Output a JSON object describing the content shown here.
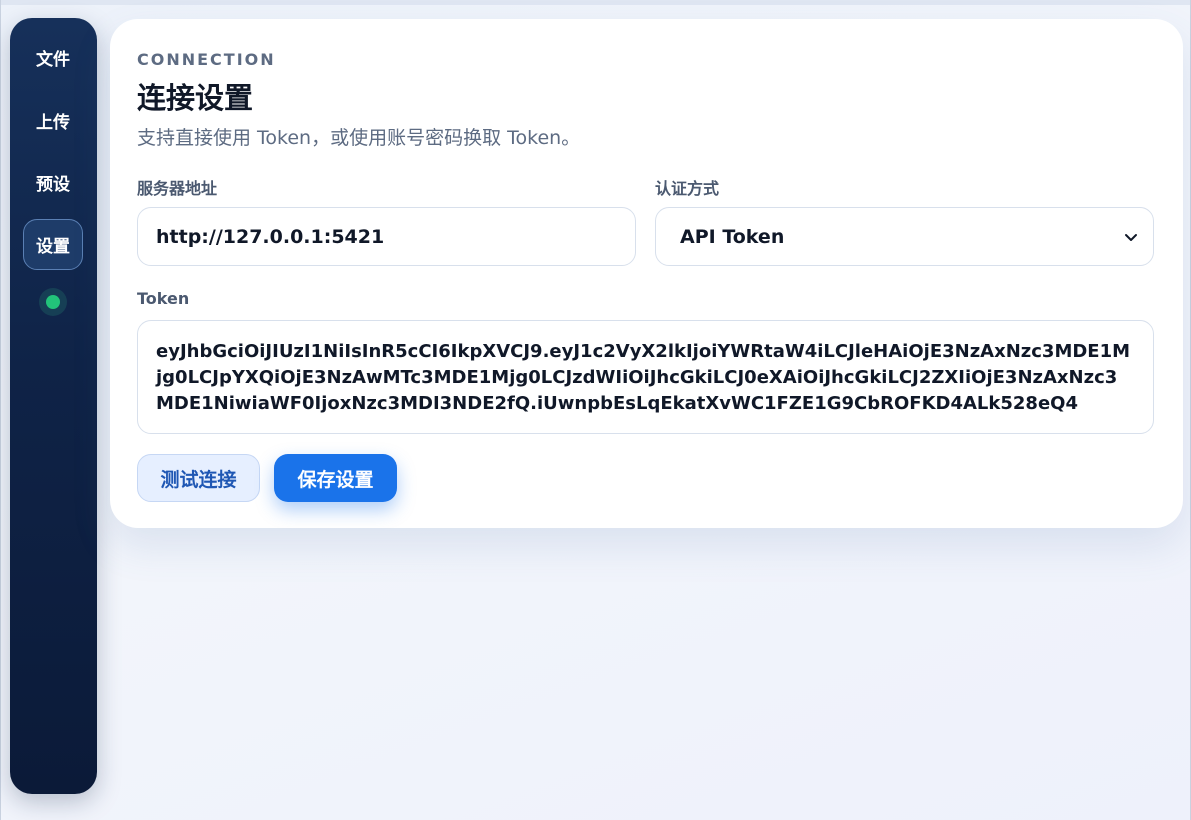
{
  "sidebar": {
    "items": [
      {
        "label": "文件"
      },
      {
        "label": "上传"
      },
      {
        "label": "预设"
      },
      {
        "label": "设置",
        "active": true
      }
    ],
    "status_color": "#22c37a"
  },
  "connection": {
    "eyebrow": "CONNECTION",
    "title": "连接设置",
    "subtitle": "支持直接使用 Token，或使用账号密码换取 Token。",
    "server_label": "服务器地址",
    "server_value": "http://127.0.0.1:5421",
    "auth_label": "认证方式",
    "auth_value": "API Token",
    "token_label": "Token",
    "token_value": "eyJhbGciOiJIUzI1NiIsInR5cCI6IkpXVCJ9.eyJ1c2VyX2lkIjoiYWRtaW4iLCJleHAiOjE3NzAxNzc3MDE1Mjg0LCJpYXQiOjE3NzAwMTc3MDE1Mjg0LCJzdWIiOiJhcGkiLCJ0eXAiOiJhcGkiLCJ2ZXIiOjE3NzAxNzc3MDE1NiwiaWF0IjoxNzc3MDI3NDE2fQ.iUwnpbEsLqEkatXvWC1FZE1G9CbROFKD4ALk528eQ4"
  },
  "actions": {
    "test_label": "测试连接",
    "save_label": "保存设置"
  },
  "colors": {
    "primary": "#1a73ea",
    "sidebar": "#0f2347"
  }
}
